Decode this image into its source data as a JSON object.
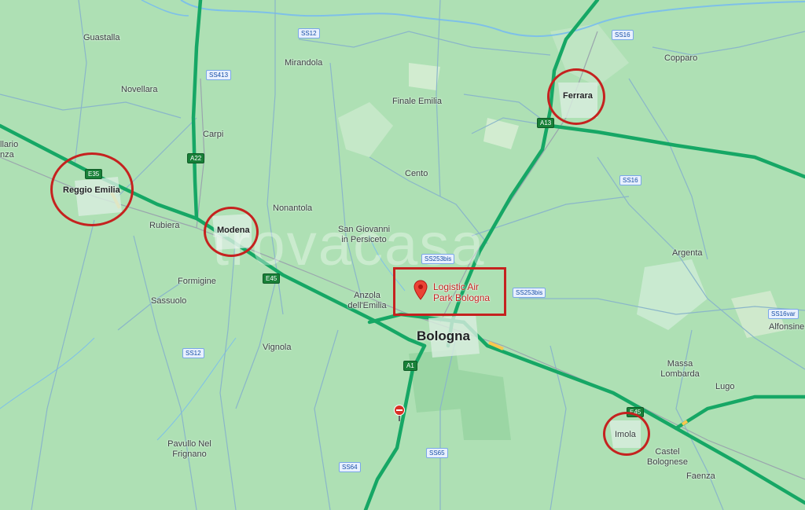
{
  "map": {
    "watermark": "trovacasa",
    "places": {
      "guastalla": "Guastalla",
      "mirandola": "Mirandola",
      "novellara": "Novellara",
      "finale_emilia": "Finale Emilia",
      "ferrara": "Ferrara",
      "copparo": "Copparo",
      "carpi": "Carpi",
      "reggio_emilia": "Reggio Emilia",
      "rubiera": "Rubiera",
      "modena": "Modena",
      "nonantola": "Nonantola",
      "cento": "Cento",
      "san_giovanni": "San Giovanni in Persiceto",
      "argenta": "Argenta",
      "formigine": "Formigine",
      "sassuolo": "Sassuolo",
      "anzola": "Anzola dell'Emilia",
      "bologna": "Bologna",
      "vignola": "Vignola",
      "massa_lombarda": "Massa Lombarda",
      "lugo": "Lugo",
      "alfonsine": "Alfonsine",
      "imola": "Imola",
      "castel_bolognese": "Castel Bolognese",
      "faenza": "Faenza",
      "pavullo": "Pavullo Nel Frignano",
      "edge_left_1": "llario",
      "edge_left_2": "nza"
    },
    "shields": {
      "ss12_top": "SS12",
      "ss16_top": "SS16",
      "ss413": "SS413",
      "a13": "A13",
      "a22": "A22",
      "e35": "E35",
      "ss16_mid": "SS16",
      "ss253bis_1": "SS253bis",
      "ss253bis_2": "SS253bis",
      "e45_left": "E45",
      "ss16var": "SS16var",
      "ss12_bottom": "SS12",
      "a1": "A1",
      "e45_right": "E45",
      "ss65": "SS65",
      "ss64": "SS64"
    },
    "poi": {
      "label": "Logistic Air Park Bologna"
    },
    "colors": {
      "land": "#aee0b4",
      "highway": "#16a765",
      "annotation": "#c5221f"
    }
  }
}
